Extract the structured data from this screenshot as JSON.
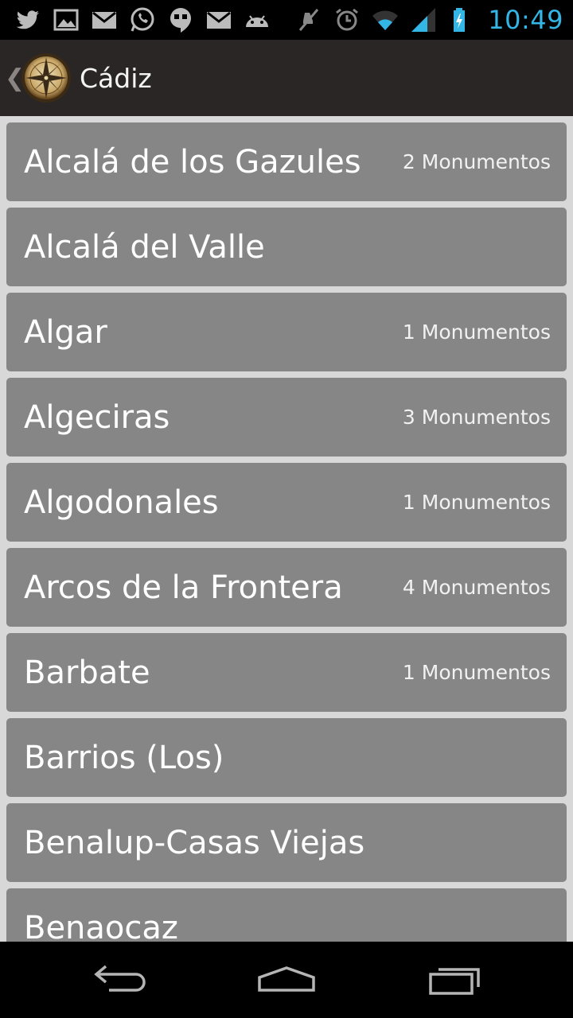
{
  "status_bar": {
    "time": "10:49",
    "left_icons": [
      "twitter-icon",
      "image-icon",
      "gmail-icon",
      "whatsapp-icon",
      "hangouts-icon",
      "gmail-icon",
      "android-icon"
    ],
    "right_icons": [
      "mute-icon",
      "alarm-icon",
      "wifi-icon",
      "signal-icon",
      "battery-charging-icon"
    ],
    "time_color": "#33b5e5"
  },
  "action_bar": {
    "title": "Cádiz",
    "up_indicator": "❮",
    "logo_icon": "compass-icon"
  },
  "list": {
    "items": [
      {
        "name": "Alcalá de los Gazules",
        "count": "2 Monumentos"
      },
      {
        "name": "Alcalá del Valle",
        "count": ""
      },
      {
        "name": "Algar",
        "count": "1 Monumentos"
      },
      {
        "name": "Algeciras",
        "count": "3 Monumentos"
      },
      {
        "name": "Algodonales",
        "count": "1 Monumentos"
      },
      {
        "name": "Arcos de la Frontera",
        "count": "4 Monumentos"
      },
      {
        "name": "Barbate",
        "count": "1 Monumentos"
      },
      {
        "name": "Barrios (Los)",
        "count": ""
      },
      {
        "name": "Benalup-Casas Viejas",
        "count": ""
      },
      {
        "name": "Benaocaz",
        "count": ""
      }
    ]
  },
  "nav_bar": {
    "buttons": [
      "back-icon",
      "home-icon",
      "recents-icon"
    ]
  }
}
